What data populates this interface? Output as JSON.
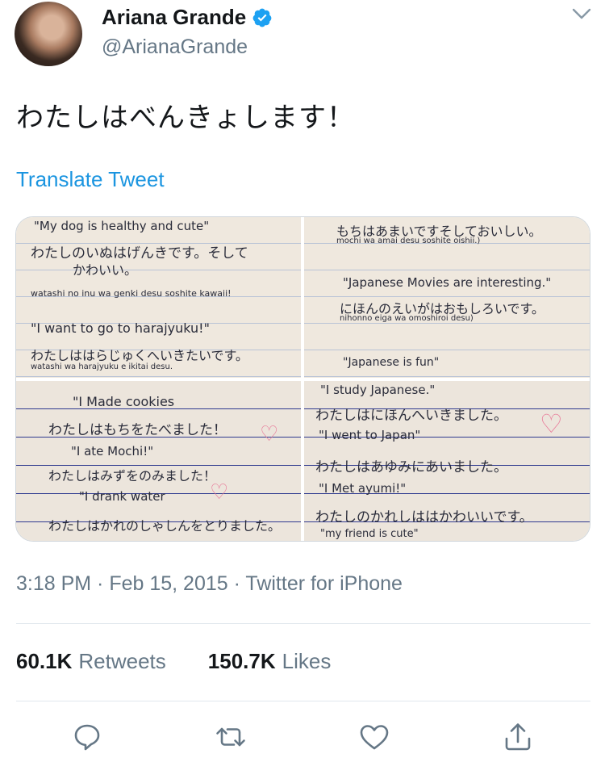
{
  "user": {
    "display_name": "Ariana Grande",
    "handle": "@ArianaGrande",
    "verified": true
  },
  "tweet": {
    "text": "わたしはべんきょします！",
    "translate_label": "Translate Tweet"
  },
  "photos": [
    {
      "lines": [
        "\"My dog is healthy and cute\"",
        "わたしのいぬはげんきです。そして",
        "かわいい。",
        "watashi no inu wa genki desu soshite kawaii!",
        "\"I want to go to harajyuku!\"",
        "わたしははらじゅくへいきたいです。",
        "watashi wa harajyuku e ikitai desu."
      ]
    },
    {
      "lines": [
        "もちはあまいですそしておいしい。",
        "mochi wa amai desu soshite oishii.)",
        "\"Japanese Movies are interesting.\"",
        "にほんのえいがはおもしろいです。",
        "nihonno eiga wa omoshiroi desu)",
        "\"Japanese is fun\""
      ]
    },
    {
      "lines": [
        "\"I Made cookies",
        "わたしはもちをたべました！",
        "\"I ate Mochi!\"",
        "わたしはみずをのみました！",
        "\"I drank water",
        "わたしはかれのしゃしんをとりました。"
      ]
    },
    {
      "lines": [
        "\"I study Japanese.\"",
        "わたしはにほんへいきました。",
        "\"I went to Japan\"",
        "わたしはあゆみにあいました。",
        "\"I Met ayumi!\"",
        "わたしのかれしははかわいいです。",
        "\"my friend is cute\""
      ]
    }
  ],
  "meta": {
    "time": "3:18 PM",
    "date": "Feb 15, 2015",
    "source": "Twitter for iPhone",
    "full": "3:18 PM · Feb 15, 2015 · Twitter for iPhone"
  },
  "stats": {
    "retweets_count": "60.1K",
    "retweets_label": "Retweets",
    "likes_count": "150.7K",
    "likes_label": "Likes"
  },
  "actions": [
    "reply-icon",
    "retweet-icon",
    "like-icon",
    "share-icon"
  ],
  "colors": {
    "link": "#1b95e0",
    "verified": "#1da1f2",
    "secondary_text": "#657786"
  }
}
